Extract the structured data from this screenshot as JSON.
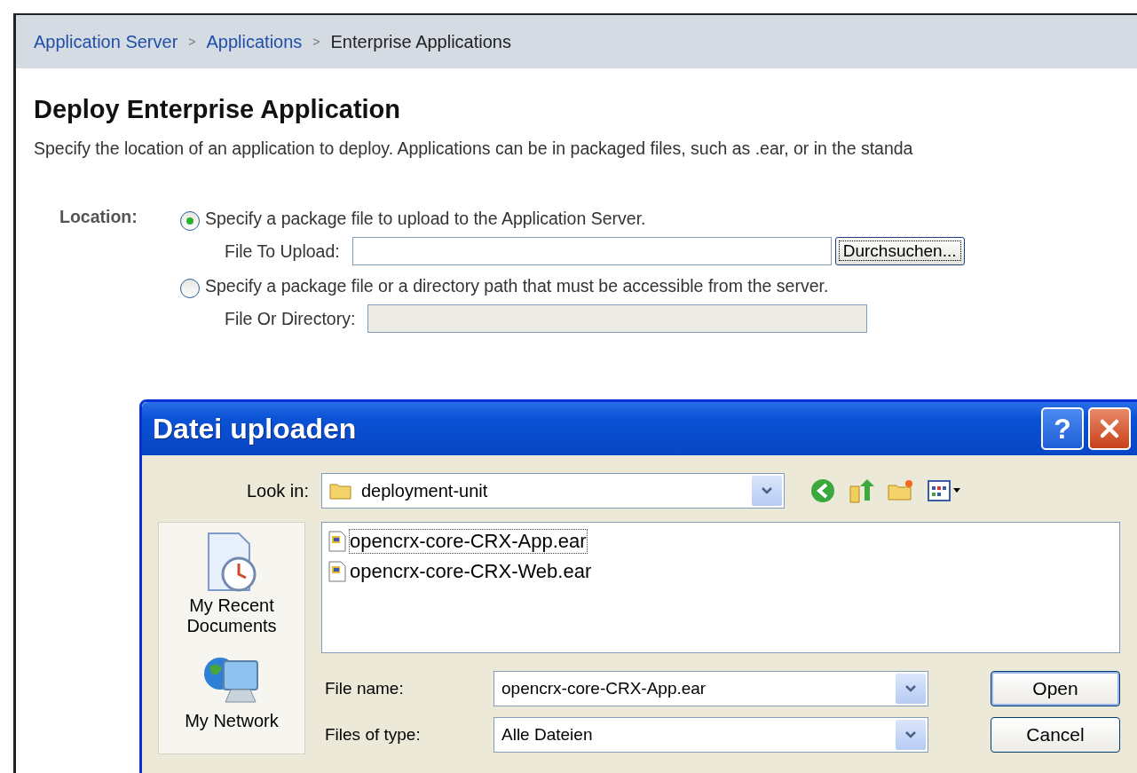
{
  "breadcrumb": [
    {
      "label": "Application Server",
      "kind": "link"
    },
    {
      "label": "Applications",
      "kind": "link"
    },
    {
      "label": "Enterprise Applications",
      "kind": "current"
    }
  ],
  "breadcrumb_separator": ">",
  "title": "Deploy Enterprise Application",
  "description": "Specify the location of an application to deploy. Applications can be in packaged files, such as .ear, or in the standa",
  "location": {
    "label": "Location:",
    "options": [
      {
        "label": "Specify a package file to upload to the Application Server.",
        "selected": true,
        "field_label": "File To Upload:",
        "disabled": false,
        "button": "Durchsuchen..."
      },
      {
        "label": "Specify a package file or a directory path that must be accessible from the server.",
        "selected": false,
        "field_label": "File Or Directory:",
        "disabled": true
      }
    ]
  },
  "dialog": {
    "title": "Datei uploaden",
    "help": "?",
    "look_in_label": "Look in:",
    "look_in": "deployment-unit",
    "places": [
      {
        "label": "My Recent Documents",
        "kind": "recent"
      },
      {
        "label": "My Network",
        "kind": "network"
      }
    ],
    "files": [
      {
        "name": "opencrx-core-CRX-App.ear",
        "selected": true
      },
      {
        "name": "opencrx-core-CRX-Web.ear",
        "selected": false
      }
    ],
    "file_name_label": "File name:",
    "file_name": "opencrx-core-CRX-App.ear",
    "file_type_label": "Files of type:",
    "file_type": "Alle Dateien",
    "buttons": [
      "Open",
      "Cancel"
    ]
  }
}
